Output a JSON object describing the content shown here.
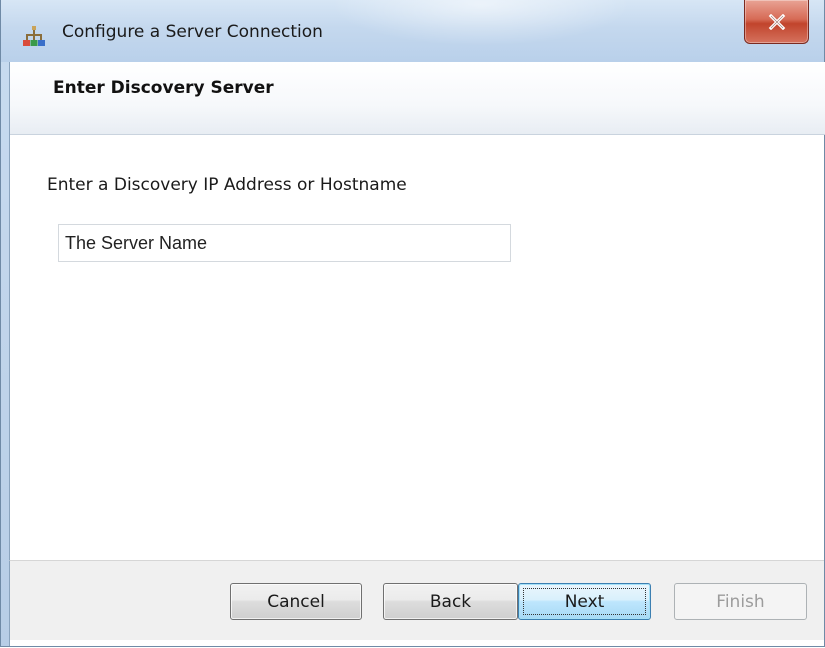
{
  "window": {
    "title": "Configure a Server Connection",
    "close_glyph": "X"
  },
  "header": {
    "title": "Enter Discovery Server"
  },
  "main": {
    "prompt_label": "Enter a Discovery IP Address or Hostname",
    "server_input_value": "The Server Name"
  },
  "buttons": {
    "cancel": "Cancel",
    "back": "Back",
    "next": "Next",
    "finish": "Finish"
  },
  "icons": {
    "app": "network-settings-icon",
    "close": "close-icon"
  },
  "colors": {
    "titlebar": "#c4d8ee",
    "close_button": "#c1442c",
    "default_button_border": "#3c7fb1",
    "disabled_text": "#9c9c9c"
  }
}
